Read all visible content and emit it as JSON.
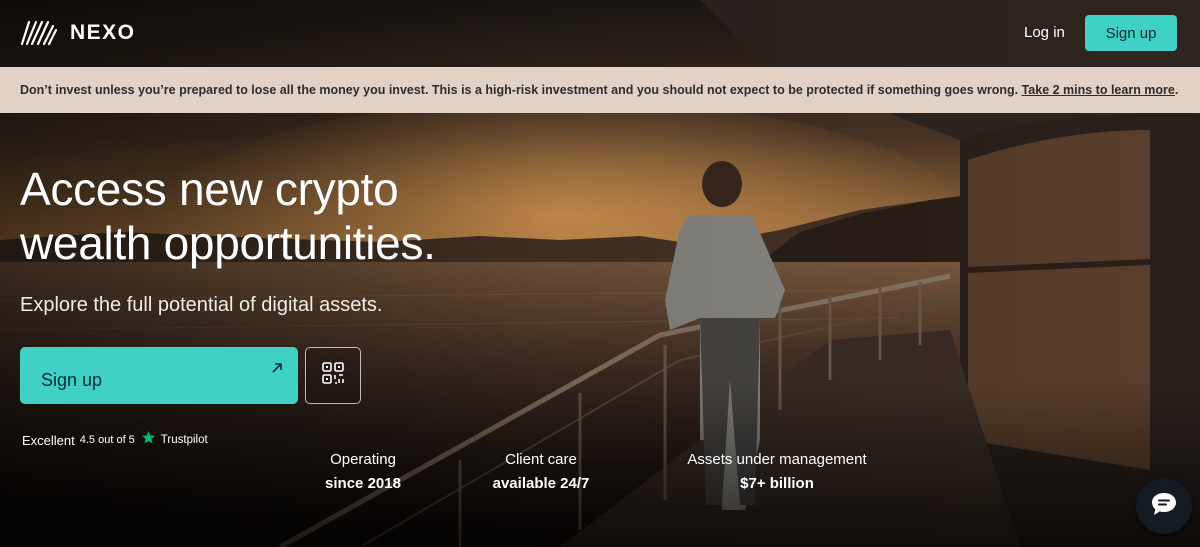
{
  "brand": {
    "name": "NEXO"
  },
  "nav": {
    "login_label": "Log in",
    "signup_label": "Sign up"
  },
  "risk_banner": {
    "text": "Don’t invest unless you’re prepared to lose all the money you invest. This is a high-risk investment and you should not expect to be protected if something goes wrong.",
    "link_text": "Take 2 mins to learn more",
    "trailing": "."
  },
  "hero": {
    "headline_line1": "Access new crypto",
    "headline_line2": "wealth opportunities.",
    "subheadline": "Explore the full potential of digital assets.",
    "signup_label": "Sign up"
  },
  "trustpilot": {
    "rating_word": "Excellent",
    "score": "4.5 out of 5",
    "brand": "Trustpilot"
  },
  "stats": [
    {
      "label": "Operating",
      "value": "since 2018"
    },
    {
      "label": "Client care",
      "value": "available 24/7"
    },
    {
      "label": "Assets under management",
      "value": "$7+ billion"
    }
  ],
  "colors": {
    "accent": "#3fd1c6",
    "banner": "#e2d2c6",
    "trustpilot_star": "#00b67a"
  },
  "icons": {
    "logo": "nexo-logo-icon",
    "signup_arrow": "arrow-up-right-icon",
    "qr": "qr-code-icon",
    "star": "trustpilot-star-icon",
    "chat": "chat-bubble-icon"
  }
}
